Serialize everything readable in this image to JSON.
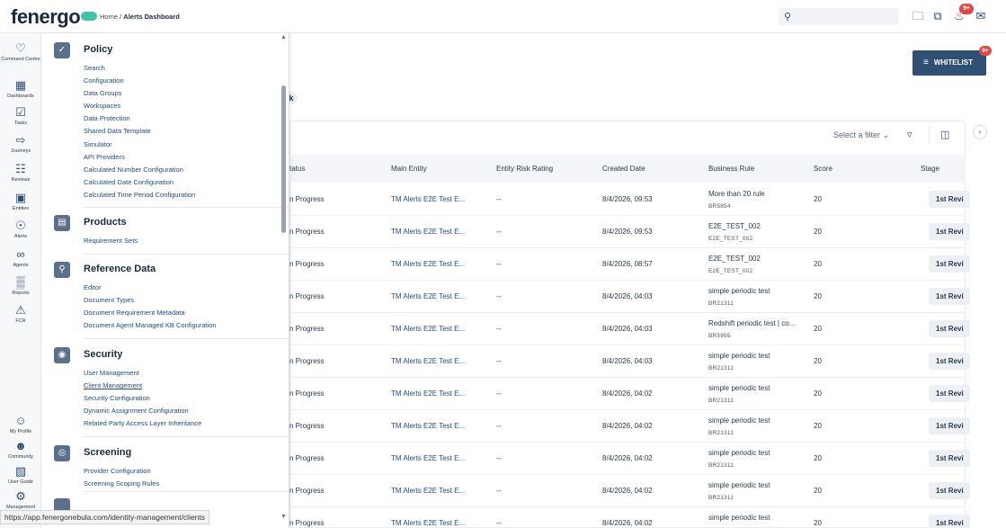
{
  "header": {
    "logo": "fenergo",
    "breadcrumb_home": "Home",
    "breadcrumb_sep": " / ",
    "breadcrumb_current": "Alerts Dashboard",
    "notif_badge": "9+"
  },
  "rail": [
    {
      "label": "Command Centre",
      "icon": "command-centre-icon"
    },
    {
      "label": "Dashboards",
      "icon": "dashboards-icon"
    },
    {
      "label": "Tasks",
      "icon": "tasks-icon"
    },
    {
      "label": "Journeys",
      "icon": "journeys-icon"
    },
    {
      "label": "Reviews",
      "icon": "reviews-icon"
    },
    {
      "label": "Entities",
      "icon": "entities-icon"
    },
    {
      "label": "Alerts",
      "icon": "alerts-icon"
    },
    {
      "label": "Agents",
      "icon": "agents-icon"
    },
    {
      "label": "Reports",
      "icon": "reports-icon"
    },
    {
      "label": "FCR",
      "icon": "fcr-icon"
    },
    {
      "label": "My Profile",
      "icon": "profile-icon"
    },
    {
      "label": "Community",
      "icon": "community-icon"
    },
    {
      "label": "User Guide",
      "icon": "user-guide-icon"
    },
    {
      "label": "Management",
      "icon": "management-icon"
    }
  ],
  "menu": {
    "policy": {
      "title": "Policy",
      "links": [
        "Search",
        "Configuration",
        "Data Groups",
        "Workspaces",
        "Data Protection",
        "Shared Data Template",
        "Simulator",
        "API Providers",
        "Calculated Number Configuration",
        "Calculated Date Configuration",
        "Calculated Time Period Configuration"
      ]
    },
    "products": {
      "title": "Products",
      "links": [
        "Requirement Sets"
      ]
    },
    "reference": {
      "title": "Reference Data",
      "links": [
        "Editor",
        "Document Types",
        "Document Requirement Metadata",
        "Document Agent Managed KB Configuration"
      ]
    },
    "security": {
      "title": "Security",
      "links": [
        "User Management",
        "Client Management",
        "Security Configuration",
        "Dynamic Assignment Configuration",
        "Related Party Access Layer Inheritance"
      ]
    },
    "screening": {
      "title": "Screening",
      "links": [
        "Provider Configuration",
        "Screening Scoping Rules"
      ]
    }
  },
  "main": {
    "whitelist_label": "WHITELIST",
    "whitelist_badge": "9+",
    "chip_text": "k",
    "filter_placeholder": "Select a filter",
    "columns": [
      "tatus",
      "Main Entity",
      "Entity Risk Rating",
      "Created Date",
      "Business Rule",
      "Score",
      "Stage"
    ],
    "rows": [
      {
        "status": "n Progress",
        "entity": "TM Alerts E2E Test E...",
        "risk": "--",
        "date": "8/4/2026, 09:53",
        "rule": "More than 20 rule",
        "rule_id": "BR5854",
        "score": "20",
        "stage": "1st Revi"
      },
      {
        "status": "n Progress",
        "entity": "TM Alerts E2E Test E...",
        "risk": "--",
        "date": "8/4/2026, 09:53",
        "rule": "E2E_TEST_002",
        "rule_id": "E2E_TEST_002",
        "score": "20",
        "stage": "1st Revi"
      },
      {
        "status": "n Progress",
        "entity": "TM Alerts E2E Test E...",
        "risk": "--",
        "date": "8/4/2026, 08:57",
        "rule": "E2E_TEST_002",
        "rule_id": "E2E_TEST_002",
        "score": "20",
        "stage": "1st Revi"
      },
      {
        "status": "n Progress",
        "entity": "TM Alerts E2E Test E...",
        "risk": "--",
        "date": "8/4/2026, 04:03",
        "rule": "simple periodic test",
        "rule_id": "BR21311",
        "score": "20",
        "stage": "1st Revi"
      },
      {
        "status": "n Progress",
        "entity": "TM Alerts E2E Test E...",
        "risk": "--",
        "date": "8/4/2026, 04:03",
        "rule": "Redshift periodic test | co...",
        "rule_id": "BR5955",
        "score": "20",
        "stage": "1st Revi"
      },
      {
        "status": "n Progress",
        "entity": "TM Alerts E2E Test E...",
        "risk": "--",
        "date": "8/4/2026, 04:03",
        "rule": "simple periodic test",
        "rule_id": "BR21311",
        "score": "20",
        "stage": "1st Revi"
      },
      {
        "status": "n Progress",
        "entity": "TM Alerts E2E Test E...",
        "risk": "--",
        "date": "8/4/2026, 04:02",
        "rule": "simple periodic test",
        "rule_id": "BR21311",
        "score": "20",
        "stage": "1st Revi"
      },
      {
        "status": "n Progress",
        "entity": "TM Alerts E2E Test E...",
        "risk": "--",
        "date": "8/4/2026, 04:02",
        "rule": "simple periodic test",
        "rule_id": "BR21311",
        "score": "20",
        "stage": "1st Revi"
      },
      {
        "status": "n Progress",
        "entity": "TM Alerts E2E Test E...",
        "risk": "--",
        "date": "8/4/2026, 04:02",
        "rule": "simple periodic test",
        "rule_id": "BR21311",
        "score": "20",
        "stage": "1st Revi"
      },
      {
        "status": "n Progress",
        "entity": "TM Alerts E2E Test E...",
        "risk": "--",
        "date": "8/4/2026, 04:02",
        "rule": "simple periodic test",
        "rule_id": "BR21311",
        "score": "20",
        "stage": "1st Revi"
      },
      {
        "status": "n Progress",
        "entity": "TM Alerts E2E Test E...",
        "risk": "--",
        "date": "8/4/2026, 04:02",
        "rule": "simple periodic test",
        "rule_id": "",
        "score": "20",
        "stage": "1st Revi"
      }
    ]
  },
  "statusbar": {
    "url": "https://app.fenergonebula.com/identity-management/clients"
  },
  "colors": {
    "primary": "#2f4f73",
    "link": "#1f4b82",
    "badge": "#e04848",
    "brand_dot": "#3cc6a3"
  }
}
